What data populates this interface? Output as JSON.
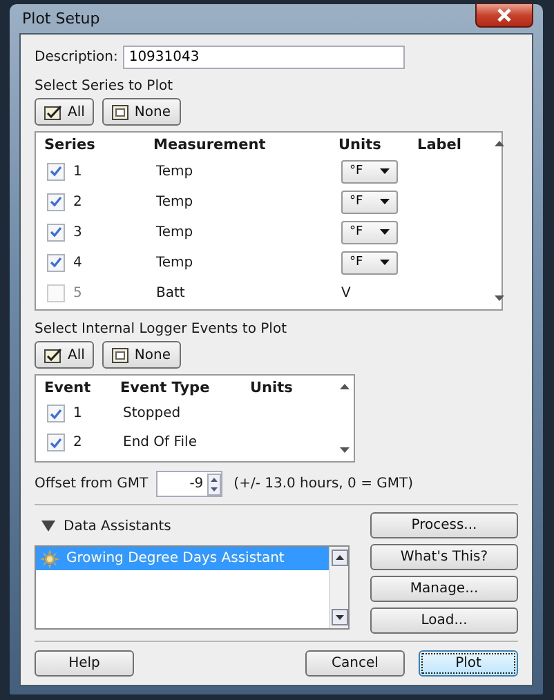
{
  "window": {
    "title": "Plot Setup"
  },
  "description": {
    "label": "Description:",
    "value": "10931043"
  },
  "series_section": {
    "label": "Select Series to Plot",
    "buttons": [
      {
        "label": "All",
        "kind": "check"
      },
      {
        "label": "None",
        "kind": "uncheck"
      }
    ],
    "columns": [
      "Series",
      "Measurement",
      "Units",
      "Label"
    ],
    "rows": [
      {
        "checked": true,
        "number": "1",
        "measurement": "Temp",
        "units": "°F",
        "kind": "dropdown"
      },
      {
        "checked": true,
        "number": "2",
        "measurement": "Temp",
        "units": "°F",
        "kind": "dropdown"
      },
      {
        "checked": true,
        "number": "3",
        "measurement": "Temp",
        "units": "°F",
        "kind": "dropdown"
      },
      {
        "checked": true,
        "number": "4",
        "measurement": "Temp",
        "units": "°F",
        "kind": "dropdown"
      },
      {
        "checked": false,
        "number": "5",
        "measurement": "Batt",
        "units": "V",
        "kind": "text"
      }
    ]
  },
  "events_section": {
    "label": "Select Internal Logger Events to Plot",
    "buttons": [
      {
        "label": "All",
        "kind": "check"
      },
      {
        "label": "None",
        "kind": "uncheck"
      }
    ],
    "columns": [
      "Event",
      "Event Type",
      "Units"
    ],
    "rows": [
      {
        "checked": true,
        "number": "1",
        "type": "Stopped"
      },
      {
        "checked": true,
        "number": "2",
        "type": "End Of File"
      }
    ]
  },
  "offset": {
    "label": "Offset from GMT",
    "value": "-9",
    "hint": "(+/- 13.0 hours, 0 = GMT)"
  },
  "data_assistants": {
    "label": "Data Assistants",
    "expanded": true,
    "items": [
      {
        "label": "Growing Degree Days Assistant",
        "selected": true
      }
    ],
    "buttons": [
      "Process...",
      "What's This?",
      "Manage...",
      "Load..."
    ]
  },
  "footer_buttons": [
    {
      "label": "Help",
      "default": false
    },
    {
      "label": "Cancel",
      "default": false
    },
    {
      "label": "Plot",
      "default": true
    }
  ]
}
